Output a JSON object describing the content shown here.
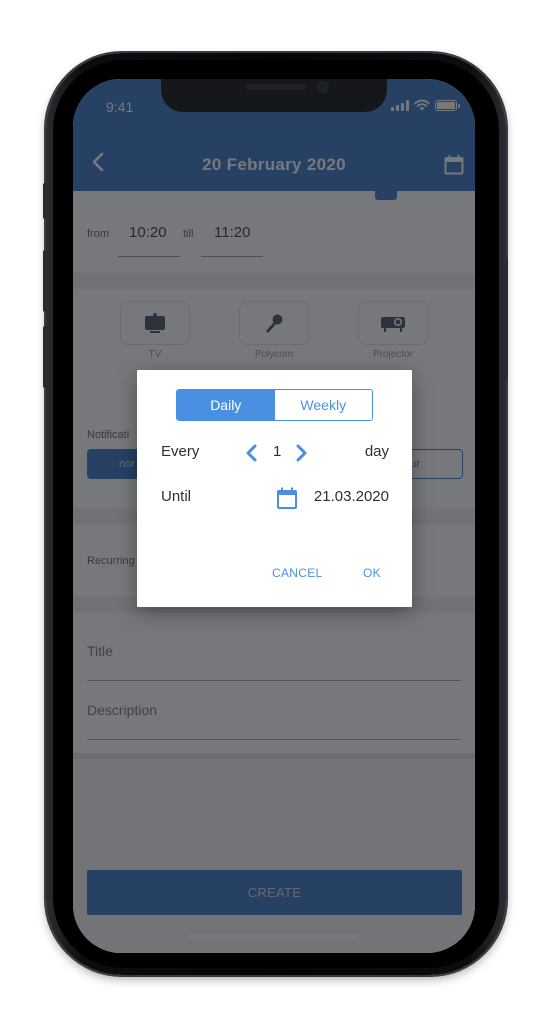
{
  "status_bar": {
    "time": "9:41"
  },
  "header": {
    "title": "20 February 2020",
    "back_icon": "chevron-left-icon",
    "calendar_icon": "calendar-icon"
  },
  "time_range": {
    "from_label": "from",
    "from_value": "10:20",
    "till_label": "till",
    "till_value": "11:20"
  },
  "equipment": [
    {
      "label": "TV",
      "icon": "tv-icon"
    },
    {
      "label": "Polycom",
      "icon": "microphone-icon"
    },
    {
      "label": "Projector",
      "icon": "projector-icon"
    }
  ],
  "notification": {
    "label": "Notificati",
    "left_chip": "nor",
    "right_chip": "our"
  },
  "recurring": {
    "label": "Recurring"
  },
  "fields": {
    "title_label": "Title",
    "description_label": "Description"
  },
  "create_button": "CREATE",
  "dialog": {
    "tabs": [
      {
        "label": "Daily",
        "active": true
      },
      {
        "label": "Weekly",
        "active": false
      }
    ],
    "every_label": "Every",
    "every_value": "1",
    "every_unit": "day",
    "until_label": "Until",
    "until_value": "21.03.2020",
    "cancel_label": "CANCEL",
    "ok_label": "OK"
  },
  "colors": {
    "brand_blue": "#2f6fc2",
    "accent_blue": "#4a90e2"
  }
}
